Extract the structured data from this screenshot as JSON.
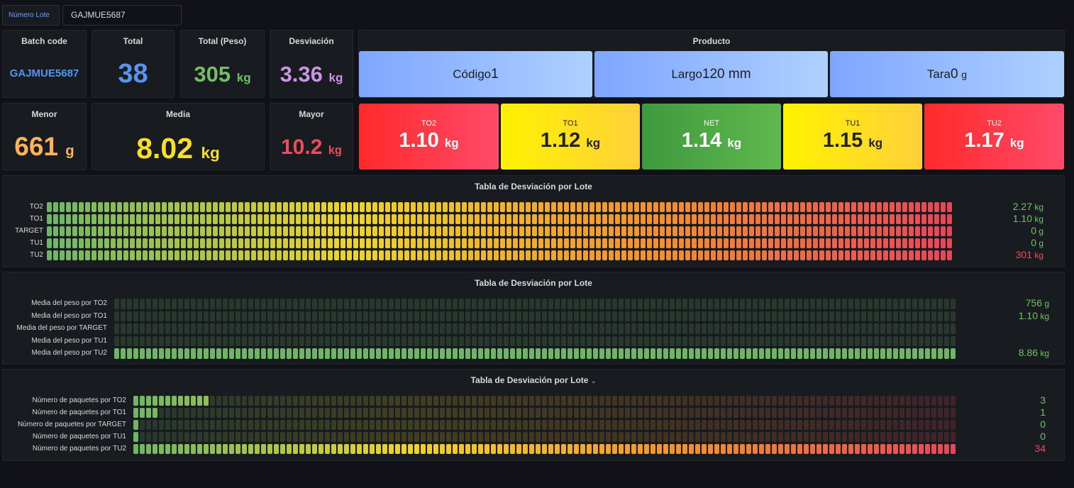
{
  "variable": {
    "label": "Número Lote",
    "value": "GAJMUE5687"
  },
  "stats": {
    "batch": {
      "title": "Batch code",
      "value": "GAJMUE5687"
    },
    "total": {
      "title": "Total",
      "value": "38"
    },
    "peso": {
      "title": "Total (Peso)",
      "value": "305",
      "unit": "kg"
    },
    "desv": {
      "title": "Desviación",
      "value": "3.36",
      "unit": "kg"
    },
    "menor": {
      "title": "Menor",
      "value": "661",
      "unit": "g"
    },
    "media": {
      "title": "Media",
      "value": "8.02",
      "unit": "kg"
    },
    "mayor": {
      "title": "Mayor",
      "value": "10.2",
      "unit": "kg"
    }
  },
  "producto": {
    "title": "Producto",
    "items": [
      {
        "label": "Código",
        "value": "1"
      },
      {
        "label": "Largo",
        "value": "120 mm"
      },
      {
        "label": "Tara",
        "value": "0",
        "unit": "g"
      }
    ]
  },
  "tolerances": [
    {
      "label": "TO2",
      "value": "1.10",
      "unit": "kg"
    },
    {
      "label": "TO1",
      "value": "1.12",
      "unit": "kg"
    },
    {
      "label": "NET",
      "value": "1.14",
      "unit": "kg"
    },
    {
      "label": "TU1",
      "value": "1.15",
      "unit": "kg"
    },
    {
      "label": "TU2",
      "value": "1.17",
      "unit": "kg"
    }
  ],
  "tables": [
    {
      "title": "Tabla de Desviación por Lote",
      "rows": [
        {
          "label": "TO2",
          "value": "2.27",
          "unit": "kg",
          "color": "#73bf69",
          "lit": 1
        },
        {
          "label": "TO1",
          "value": "1.10",
          "unit": "kg",
          "color": "#73bf69",
          "lit": 1
        },
        {
          "label": "TARGET",
          "value": "0",
          "unit": "g",
          "color": "#73bf69",
          "lit": 1
        },
        {
          "label": "TU1",
          "value": "0",
          "unit": "g",
          "color": "#73bf69",
          "lit": 1
        },
        {
          "label": "TU2",
          "value": "301",
          "unit": "kg",
          "color": "#f2495c",
          "lit": 1.0
        }
      ]
    },
    {
      "title": "Tabla de Desviación por Lote",
      "rows": [
        {
          "label": "Media del peso por TO2",
          "value": "756",
          "unit": "g",
          "color": "#73bf69",
          "lit": 0
        },
        {
          "label": "Media del peso por TO1",
          "value": "1.10",
          "unit": "kg",
          "color": "#73bf69",
          "lit": 0
        },
        {
          "label": "Media del peso por TARGET",
          "value": "",
          "unit": "",
          "color": "#73bf69",
          "lit": 0
        },
        {
          "label": "Media del peso por TU1",
          "value": "",
          "unit": "",
          "color": "#73bf69",
          "lit": 0
        },
        {
          "label": "Media del peso por TU2",
          "value": "8.86",
          "unit": "kg",
          "color": "#73bf69",
          "lit": 1.0
        }
      ]
    },
    {
      "title": "Tabla de Desviación por Lote",
      "has_menu": true,
      "rows": [
        {
          "label": "Número de paquetes por TO2",
          "value": "3",
          "unit": "",
          "color": "#73bf69",
          "lit": 0.09
        },
        {
          "label": "Número de paquetes por TO1",
          "value": "1",
          "unit": "",
          "color": "#73bf69",
          "lit": 0.03
        },
        {
          "label": "Número de paquetes por TARGET",
          "value": "0",
          "unit": "",
          "color": "#73bf69",
          "lit": 0.01
        },
        {
          "label": "Número de paquetes por TU1",
          "value": "0",
          "unit": "",
          "color": "#73bf69",
          "lit": 0.01
        },
        {
          "label": "Número de paquetes por TU2",
          "value": "34",
          "unit": "",
          "color": "#f2495c",
          "lit": 1.0
        }
      ]
    }
  ],
  "colors": {
    "accent": "#5794f2",
    "green": "#73bf69",
    "yellow": "#fade2a",
    "red": "#f2495c",
    "purple": "#ca95e5",
    "orange": "#ffb357"
  }
}
